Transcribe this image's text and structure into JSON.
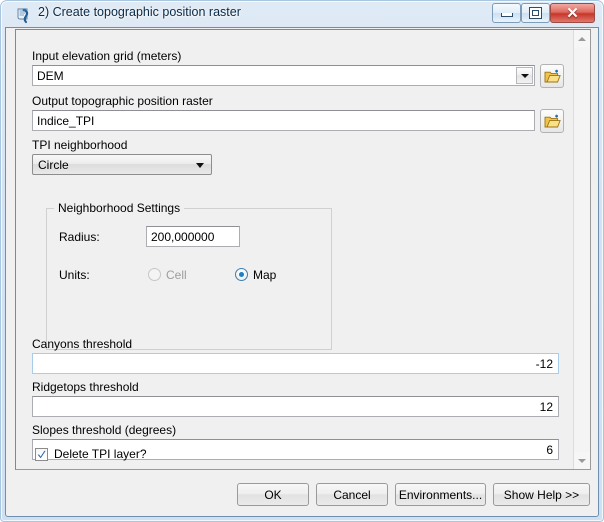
{
  "window": {
    "title": "2) Create topographic position raster",
    "icon": "script-tool-icon",
    "controls": {
      "minimize": "minimize-button",
      "maximize": "maximize-button",
      "close_glyph": "✕"
    }
  },
  "form": {
    "input_elevation": {
      "label": "Input elevation grid (meters)",
      "value": "DEM",
      "browse": "browse-folder-icon"
    },
    "output_raster": {
      "label": "Output topographic position raster",
      "value": "Indice_TPI",
      "browse": "browse-folder-icon"
    },
    "tpi_neighborhood": {
      "label": "TPI neighborhood",
      "value": "Circle"
    },
    "neighborhood_settings": {
      "group_title": "Neighborhood Settings",
      "radius_label": "Radius:",
      "radius_value": "200,000000",
      "units_label": "Units:",
      "units_options": [
        "Cell",
        "Map"
      ],
      "units_selected": "Map"
    },
    "canyons_threshold": {
      "label": "Canyons threshold",
      "value": "-12"
    },
    "ridgetops_threshold": {
      "label": "Ridgetops threshold",
      "value": "12"
    },
    "slopes_threshold": {
      "label": "Slopes threshold (degrees)",
      "value": "6"
    },
    "delete_tpi_layer": {
      "label": "Delete TPI layer?",
      "checked": true
    }
  },
  "buttons": {
    "ok": "OK",
    "cancel": "Cancel",
    "environments": "Environments...",
    "show_help": "Show Help >>"
  },
  "colors": {
    "accent": "#1d7fc4",
    "frame": "#cfe0f1",
    "panel": "#f0f0f0",
    "close_red": "#c8362a",
    "folder_gold": "#f5c341"
  }
}
